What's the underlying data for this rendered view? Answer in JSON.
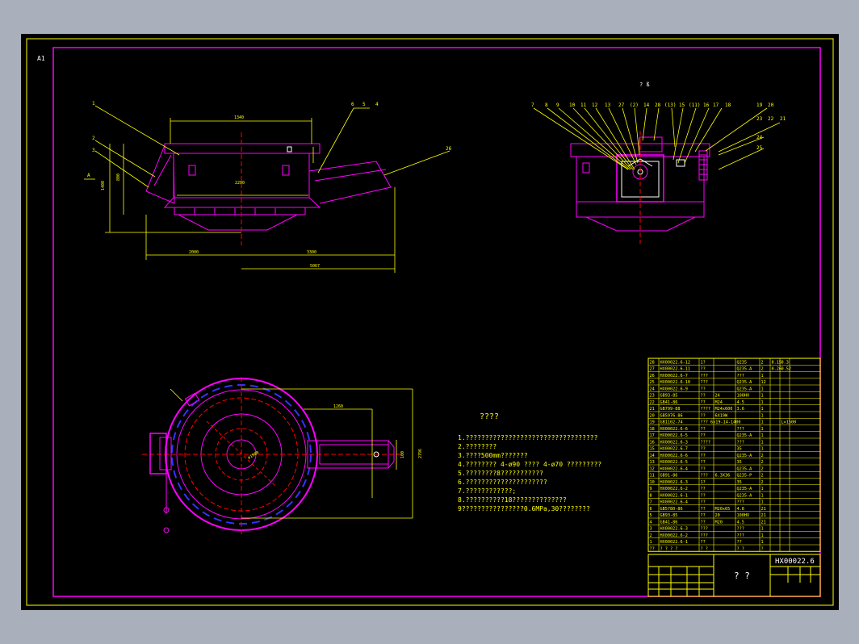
{
  "sheet_size": "A1",
  "top_right_note": "? ß",
  "front_view_callouts": [
    "1",
    "2",
    "3",
    "6",
    "5",
    "4",
    "26"
  ],
  "front_view_section_mark": "A",
  "side_view_callouts": [
    "7",
    "8",
    "9",
    "10",
    "11",
    "12",
    "13",
    "27",
    "(2)",
    "14",
    "28",
    "(13)",
    "15",
    "(11)",
    "16",
    "17",
    "18",
    "19",
    "20",
    "23",
    "22",
    "21",
    "24",
    "25"
  ],
  "notes_title": "????",
  "notes": [
    "1.??????????????????????????????????",
    "2.????????",
    "3.????500mm???????",
    "4.???????? 4-ø90 ???? 4-ø70 ?????????",
    "5.????????8???????????",
    "6.?????????????????????",
    "7.????????????;",
    "8.??????????18??????????????",
    "9????????????????0.6MPa,30????????"
  ],
  "parts_table": {
    "rows": [
      {
        "no": "28",
        "code": "HX00022.6-12",
        "name": "1?",
        "qty": "",
        "mat": "Q235",
        "n2": "2",
        "w1": "0.15",
        "w2": "0.3"
      },
      {
        "no": "27",
        "code": "HX00022.6-11",
        "name": "??",
        "qty": "",
        "mat": "Q235-A",
        "n2": "2",
        "w1": "0.26",
        "w2": "0.52"
      },
      {
        "no": "26",
        "code": "HX00022.6-7",
        "name": "???",
        "qty": "",
        "mat": "???",
        "n2": "1",
        "w1": "",
        "w2": ""
      },
      {
        "no": "25",
        "code": "HX00022.6-10",
        "name": "???",
        "qty": "",
        "mat": "Q235-A",
        "n2": "12",
        "w1": "",
        "w2": ""
      },
      {
        "no": "24",
        "code": "HX00022.6-9",
        "name": "??",
        "qty": "",
        "mat": "Q235-A",
        "n2": "1",
        "w1": "",
        "w2": ""
      },
      {
        "no": "23",
        "code": "GB93-85",
        "name": "??",
        "qty": "24",
        "mat": "100HV",
        "n2": "1",
        "w1": "",
        "w2": ""
      },
      {
        "no": "22",
        "code": "GB41-86",
        "name": "??",
        "qty": "M24",
        "mat": "4.5",
        "n2": "1",
        "w1": "",
        "w2": ""
      },
      {
        "no": "21",
        "code": "GB799-88",
        "name": "????",
        "qty": "M24x600",
        "mat": "3.6",
        "n2": "1",
        "w1": "",
        "w2": ""
      },
      {
        "no": "20",
        "code": "GB5976-86",
        "name": "??",
        "qty": "6X19W",
        "mat": "",
        "n2": "1",
        "w1": "",
        "w2": ""
      },
      {
        "no": "19",
        "code": "GB1102-74",
        "name": "??? 6x19-14-1400",
        "qty": "",
        "mat": "",
        "n2": "1",
        "w1": "",
        "w2": "L=1500"
      },
      {
        "no": "18",
        "code": "HX00022.6-6",
        "name": "??",
        "qty": "",
        "mat": "???",
        "n2": "1",
        "w1": "",
        "w2": ""
      },
      {
        "no": "17",
        "code": "HX00022.6-5",
        "name": "??",
        "qty": "",
        "mat": "Q235-A",
        "n2": "1",
        "w1": "",
        "w2": ""
      },
      {
        "no": "16",
        "code": "HX00022.6-3",
        "name": "????",
        "qty": "",
        "mat": "???",
        "n2": "1",
        "w1": "",
        "w2": ""
      },
      {
        "no": "15",
        "code": "HX00022.6-7",
        "name": "??",
        "qty": "",
        "mat": "35",
        "n2": "1",
        "w1": "",
        "w2": ""
      },
      {
        "no": "14",
        "code": "HX00022.6-6",
        "name": "??",
        "qty": "",
        "mat": "Q235-A",
        "n2": "2",
        "w1": "",
        "w2": ""
      },
      {
        "no": "13",
        "code": "HX00022.6-5",
        "name": "??",
        "qty": "",
        "mat": "35",
        "n2": "2",
        "w1": "",
        "w2": ""
      },
      {
        "no": "12",
        "code": "HX00022.6-4",
        "name": "??",
        "qty": "",
        "mat": "Q235-A",
        "n2": "2",
        "w1": "",
        "w2": ""
      },
      {
        "no": "11",
        "code": "GB91-86",
        "name": "???",
        "qty": "6.3X36",
        "mat": "Q235-P",
        "n2": "2",
        "w1": "",
        "w2": ""
      },
      {
        "no": "10",
        "code": "HX00022.6-3",
        "name": "1?",
        "qty": "",
        "mat": "35",
        "n2": "2",
        "w1": "",
        "w2": ""
      },
      {
        "no": "9",
        "code": "HX00022.6-2",
        "name": "??",
        "qty": "",
        "mat": "Q235-A",
        "n2": "1",
        "w1": "",
        "w2": ""
      },
      {
        "no": "8",
        "code": "HX00022.6-1",
        "name": "??",
        "qty": "",
        "mat": "Q235-A",
        "n2": "1",
        "w1": "",
        "w2": ""
      },
      {
        "no": "7",
        "code": "HX00022.6-4",
        "name": "??",
        "qty": "",
        "mat": "???",
        "n2": "1",
        "w1": "",
        "w2": ""
      },
      {
        "no": "6",
        "code": "GB5780-86",
        "name": "??",
        "qty": "M20x65",
        "mat": "4.8",
        "n2": "21",
        "w1": "",
        "w2": ""
      },
      {
        "no": "5",
        "code": "GB93-85",
        "name": "??",
        "qty": "20",
        "mat": "100HV",
        "n2": "21",
        "w1": "",
        "w2": ""
      },
      {
        "no": "4",
        "code": "GB41-86",
        "name": "??",
        "qty": "M20",
        "mat": "4.5",
        "n2": "21",
        "w1": "",
        "w2": ""
      },
      {
        "no": "3",
        "code": "HX00022.6-3",
        "name": "???",
        "qty": "",
        "mat": "???",
        "n2": "1",
        "w1": "",
        "w2": ""
      },
      {
        "no": "2",
        "code": "HX00022.6-2",
        "name": "???",
        "qty": "",
        "mat": "???",
        "n2": "1",
        "w1": "",
        "w2": ""
      },
      {
        "no": "1",
        "code": "HX00022.6-1",
        "name": "??",
        "qty": "",
        "mat": "??",
        "n2": "1",
        "w1": "",
        "w2": ""
      }
    ],
    "header": {
      "no": "??",
      "code": "? ? ? ?",
      "name": "? ?",
      "mat": "? ?",
      "n2": "?",
      "w1": "",
      "w2": ""
    }
  },
  "title_block": {
    "drawing_number": "HX00022.6",
    "title": "? ?"
  },
  "colors": {
    "frame": "#ff00ff",
    "geometry": "#ff00ff",
    "dimension": "#ffff00",
    "text": "#ffffff",
    "centerline": "#ff0000",
    "detail": "#ffffff",
    "sheet_border": "#ffff00"
  }
}
